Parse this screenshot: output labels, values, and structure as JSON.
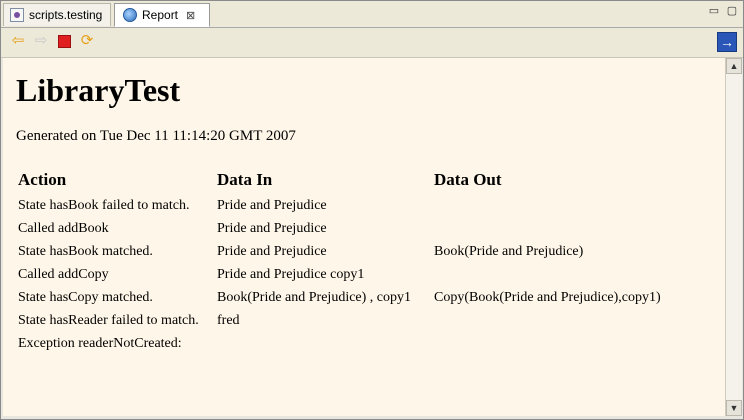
{
  "tabs": [
    {
      "label": "scripts.testing",
      "icon": "script-file-icon",
      "active": false
    },
    {
      "label": "Report",
      "icon": "globe-icon",
      "active": true
    }
  ],
  "window_controls": {
    "minimize": "▭",
    "maximize": "▢"
  },
  "toolbar": {
    "back": "⇦",
    "forward": "⇨",
    "refresh": "⟳",
    "go": "→"
  },
  "report": {
    "title": "LibraryTest",
    "generated": "Generated on Tue Dec 11 11:14:20 GMT 2007",
    "columns": [
      "Action",
      "Data In",
      "Data Out"
    ],
    "rows": [
      [
        "State hasBook failed to match.",
        "Pride and Prejudice",
        ""
      ],
      [
        "Called addBook",
        "Pride and Prejudice",
        ""
      ],
      [
        "State hasBook matched.",
        "Pride and Prejudice",
        "Book(Pride and Prejudice)"
      ],
      [
        "Called addCopy",
        "Pride and Prejudice copy1",
        ""
      ],
      [
        "State hasCopy matched.",
        "Book(Pride and Prejudice) , copy1",
        "Copy(Book(Pride and Prejudice),copy1)"
      ],
      [
        "State hasReader failed to match.",
        "fred",
        ""
      ],
      [
        "Exception readerNotCreated:",
        "",
        ""
      ]
    ]
  },
  "scrollbar": {
    "up": "▲",
    "down": "▼"
  }
}
